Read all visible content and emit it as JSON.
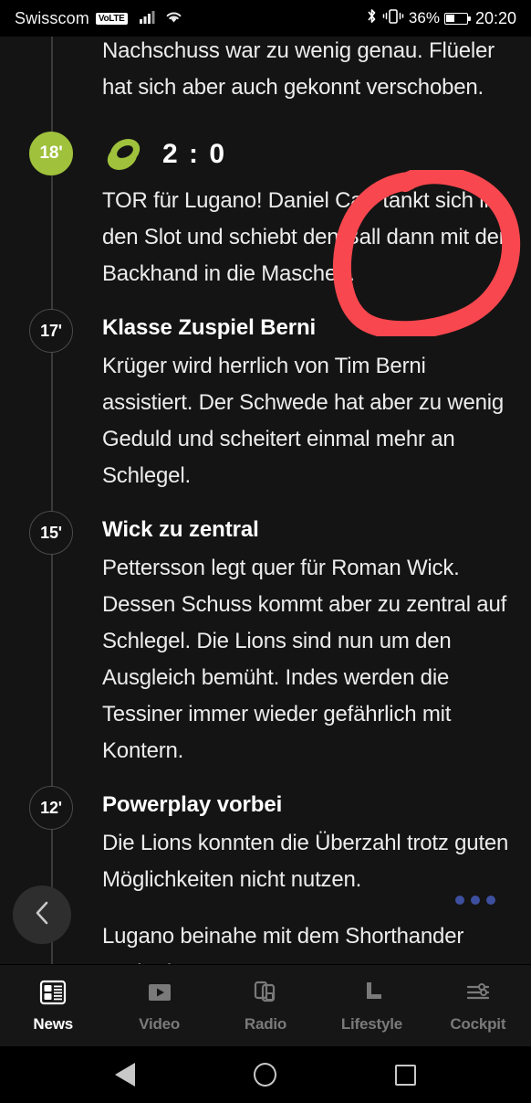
{
  "status_bar": {
    "carrier": "Swisscom",
    "network_badge": "VoLTE",
    "battery_percent": "36%",
    "clock": "20:20",
    "icons": [
      "signal-bars-icon",
      "wifi-icon",
      "bluetooth-icon",
      "vibrate-icon",
      "battery-icon"
    ]
  },
  "ticker": {
    "partial_top_text": "Nachschuss war zu wenig genau. Flüeler hat sich aber auch gekonnt verschoben.",
    "entries": [
      {
        "minute": "18'",
        "type": "goal",
        "icon": "puck-icon",
        "score": "2 : 0",
        "title": "",
        "text": "TOR für Lugano! Daniel Carr tankt sich in den Slot und schiebt den Ball dann mit der Backhand in die Maschen."
      },
      {
        "minute": "17'",
        "type": "event",
        "title": "Klasse Zuspiel Berni",
        "text": "Krüger wird herrlich von Tim Berni assistiert. Der Schwede hat aber zu wenig Geduld und scheitert einmal mehr an Schlegel."
      },
      {
        "minute": "15'",
        "type": "event",
        "title": "Wick zu zentral",
        "text": "Pettersson legt quer für Roman Wick. Dessen Schuss kommt aber zu zentral auf Schlegel. Die Lions sind nun um den Ausgleich bemüht. Indes werden die Tessiner immer wieder gefährlich mit Kontern."
      },
      {
        "minute": "12'",
        "type": "event",
        "title": "Powerplay vorbei",
        "text": "Die Lions konnten die Überzahl trotz guten Möglichkeiten nicht nutzen."
      },
      {
        "minute": "",
        "type": "event",
        "title": "",
        "text": "Lugano beinahe mit dem Shorthander nach einem Konter."
      }
    ]
  },
  "annotation": {
    "shape": "hand-drawn-circle",
    "color": "#f8474e"
  },
  "floating": {
    "back_icon": "chevron-left-icon",
    "loading_dots": "•••",
    "dots_color": "#3d4f9e"
  },
  "bottom_nav": {
    "active": "News",
    "items": [
      {
        "label": "News",
        "icon": "news-layout-icon",
        "active": true
      },
      {
        "label": "Video",
        "icon": "play-icon",
        "active": false
      },
      {
        "label": "Radio",
        "icon": "radio-icon",
        "active": false
      },
      {
        "label": "Lifestyle",
        "icon": "lifestyle-icon",
        "active": false
      },
      {
        "label": "Cockpit",
        "icon": "sliders-icon",
        "active": false
      }
    ]
  },
  "android_nav": {
    "back": "back-triangle-icon",
    "home": "home-circle-icon",
    "recents": "recents-square-icon"
  },
  "colors": {
    "accent_green": "#9fc13c",
    "annotation_red": "#f8474e",
    "background": "#141414"
  }
}
